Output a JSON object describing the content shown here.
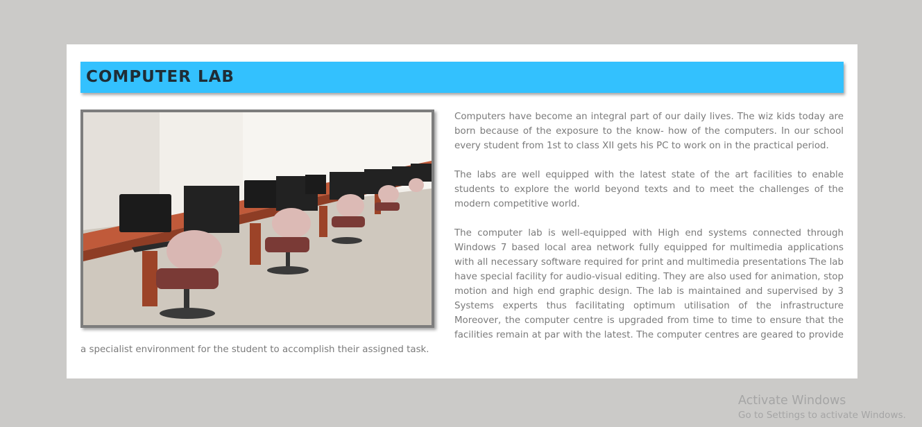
{
  "section": {
    "title": "COMPUTER LAB",
    "paragraphs": [
      "Computers have become an integral part of our daily lives. The wiz kids today are born because of the exposure to the know- how of the computers. In our school every student from 1st to class XII gets his PC to work on in the practical period.",
      "The labs are well equipped with the latest state of the art facilities to enable students to explore the world beyond texts and to meet the challenges of the modern competitive world.",
      "The computer lab is well-equipped with High end systems connected through Windows 7 based local area network fully equipped for multimedia applications with all necessary software required for print and multimedia presentations The lab have special facility for audio-visual editing. They are also used for animation, stop motion and high end graphic design. The lab is maintained and supervised by 3 Systems experts thus facilitating optimum utilisation of the infrastructure Moreover, the computer centre is upgraded from time to time to ensure that the facilities remain at par with the latest. The computer centres are geared to provide a specialist environment for the student to accomplish their assigned task."
    ]
  },
  "watermark": {
    "title": "Activate Windows",
    "subtitle": "Go to Settings to activate Windows."
  },
  "colors": {
    "page_background": "#cbcac8",
    "title_bar": "#33c1fe",
    "title_text": "#1f2d36",
    "body_text": "#7a7a7a",
    "photo_border": "#7d7d7d"
  }
}
